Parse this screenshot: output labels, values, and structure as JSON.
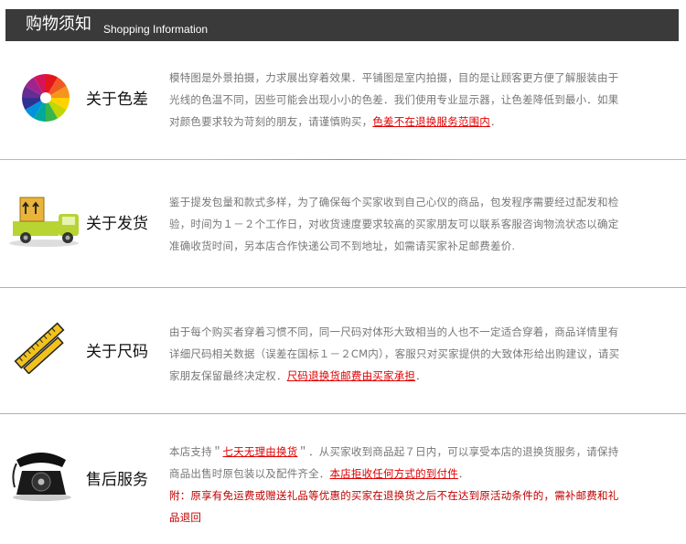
{
  "header": {
    "title_cn": "购物须知",
    "title_en": "Shopping Information"
  },
  "sections": [
    {
      "title": "关于色差",
      "text_before": "模特图是外景拍摄，力求展出穿着效果．平铺图是室内拍摄，目的是让顾客更方便了解服装由于光线的色温不同，因些可能会出现小小的色差．我们使用专业显示器，让色差降低到最小．如果对颜色要求较为苛刻的朋友，请谨慎购买，",
      "highlight": "色差不在退换服务范围内",
      "text_after": "．"
    },
    {
      "title": "关于发货",
      "text": "鉴于提发包量和款式多样，为了确保每个买家收到自己心仪的商品，包发程序需要经过配发和检验，时间为１－２个工作日，对收货速度要求较高的买家朋友可以联系客服咨询物流状态以确定准确收货时间，另本店合作快递公司不到地址，如需请买家补足邮费差价."
    },
    {
      "title": "关于尺码",
      "text_before": "由于每个购买者穿着习惯不同，同一尺码对体形大致相当的人也不一定适合穿着，商品详情里有详细尺码相关数据（误差在国标１－２CM内），客服只对买家提供的大致体形给出购建议，请买家朋友保留最终决定权．",
      "highlight": "尺码退换货邮费由买家承担",
      "text_after": "．"
    },
    {
      "title": "售后服务",
      "text_before": "本店支持＂",
      "highlight1": "七天无理由换货",
      "text_mid": "＂．从买家收到商品起７日内，可以享受本店的退换货服务，请保持商品出售时原包装以及配件齐全．",
      "highlight2": "本店拒收任何方式的到付件",
      "text_after": "．",
      "note": "附：原享有免运费或赠送礼品等优惠的买家在退换货之后不在达到原活动条件的，需补邮费和礼品退回"
    }
  ],
  "icons": [
    "color-wheel-icon",
    "delivery-truck-icon",
    "measuring-ruler-icon",
    "telephone-icon"
  ]
}
